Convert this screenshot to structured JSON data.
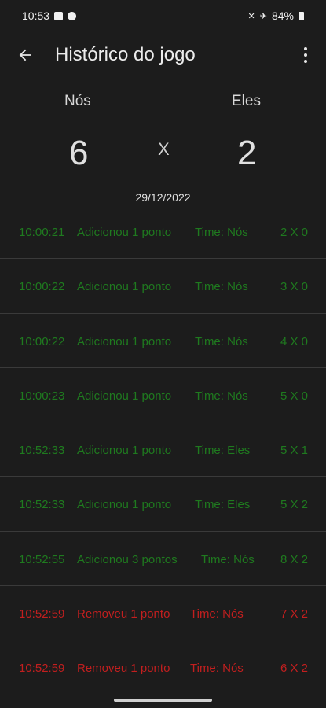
{
  "status_bar": {
    "time": "10:53",
    "battery": "84%"
  },
  "app_bar": {
    "title": "Histórico do jogo"
  },
  "scoreboard": {
    "team_left": "Nós",
    "team_right": "Eles",
    "score_left": "6",
    "score_right": "2",
    "versus": "X",
    "date": "29/12/2022"
  },
  "history": [
    {
      "time": "10:00:21",
      "action": "Adicionou 1 ponto",
      "team": "Time: Nós",
      "score": "2 X 0",
      "type": "add"
    },
    {
      "time": "10:00:22",
      "action": "Adicionou 1 ponto",
      "team": "Time: Nós",
      "score": "3 X 0",
      "type": "add"
    },
    {
      "time": "10:00:22",
      "action": "Adicionou 1 ponto",
      "team": "Time: Nós",
      "score": "4 X 0",
      "type": "add"
    },
    {
      "time": "10:00:23",
      "action": "Adicionou 1 ponto",
      "team": "Time: Nós",
      "score": "5 X 0",
      "type": "add"
    },
    {
      "time": "10:52:33",
      "action": "Adicionou 1 ponto",
      "team": "Time: Eles",
      "score": "5 X 1",
      "type": "add"
    },
    {
      "time": "10:52:33",
      "action": "Adicionou 1 ponto",
      "team": "Time: Eles",
      "score": "5 X 2",
      "type": "add"
    },
    {
      "time": "10:52:55",
      "action": "Adicionou 3 pontos",
      "team": "Time: Nós",
      "score": "8 X 2",
      "type": "add"
    },
    {
      "time": "10:52:59",
      "action": "Removeu 1 ponto",
      "team": "Time: Nós",
      "score": "7 X 2",
      "type": "remove"
    },
    {
      "time": "10:52:59",
      "action": "Removeu 1 ponto",
      "team": "Time: Nós",
      "score": "6 X 2",
      "type": "remove"
    }
  ],
  "colors": {
    "background": "#1c1c1c",
    "add": "#1f7a1f",
    "remove": "#c21f1f"
  },
  "icons": {
    "back": "arrow-left-icon",
    "menu": "more-vert-icon"
  }
}
